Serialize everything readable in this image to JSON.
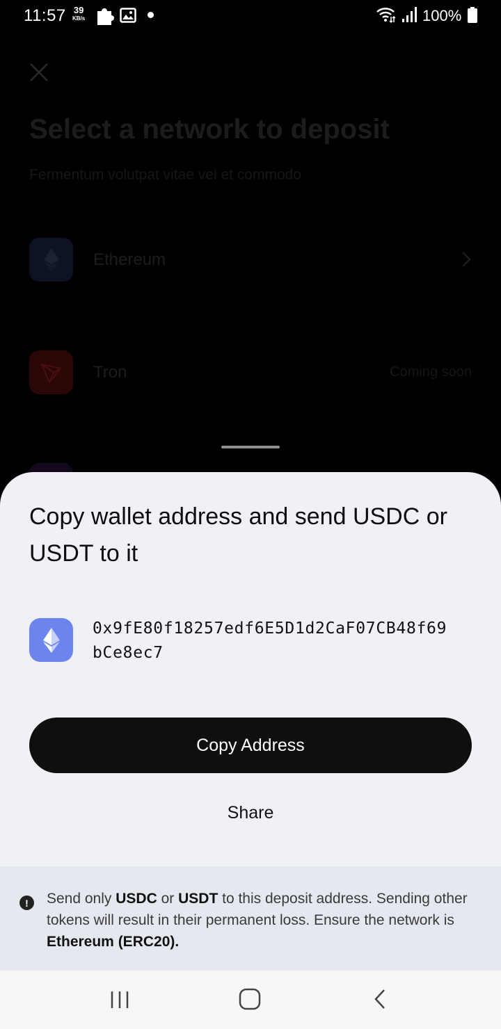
{
  "status_bar": {
    "time": "11:57",
    "speed_value": "39",
    "speed_unit": "KB/s",
    "battery": "100%",
    "icons": [
      "puzzle-icon",
      "image-icon",
      "dot-icon",
      "wifi-icon",
      "signal-icon",
      "battery-icon"
    ]
  },
  "background_page": {
    "title": "Select a network to deposit",
    "subtitle": "Fermentum volutpat vitae vel et commodo",
    "networks": [
      {
        "label": "Ethereum",
        "icon": "ethereum-icon",
        "trailing": "chevron-right-icon"
      },
      {
        "label": "Tron",
        "icon": "tron-icon",
        "badge": "Coming soon"
      }
    ]
  },
  "sheet": {
    "title": "Copy wallet address and send USDC or USDT to it",
    "network_icon": "ethereum-icon",
    "address": "0x9fE80f18257edf6E5D1d2CaF07CB48f69bCe8ec7",
    "copy_label": "Copy Address",
    "share_label": "Share",
    "warning": {
      "icon": "exclamation-icon",
      "part1": "Send only ",
      "token1": "USDC",
      "part2": " or ",
      "token2": "USDT",
      "part3": " to this deposit address. Sending other tokens will result in their permanent loss. Ensure the network is ",
      "network": "Ethereum (ERC20)."
    }
  },
  "nav_bar": {
    "icons": [
      "recents-icon",
      "home-icon",
      "back-icon"
    ]
  },
  "colors": {
    "sheet_background": "#eff1f7",
    "button_background": "#0f0f10",
    "ethereum_accent": "#6b84ee",
    "warning_background": "#e6e8ef"
  }
}
